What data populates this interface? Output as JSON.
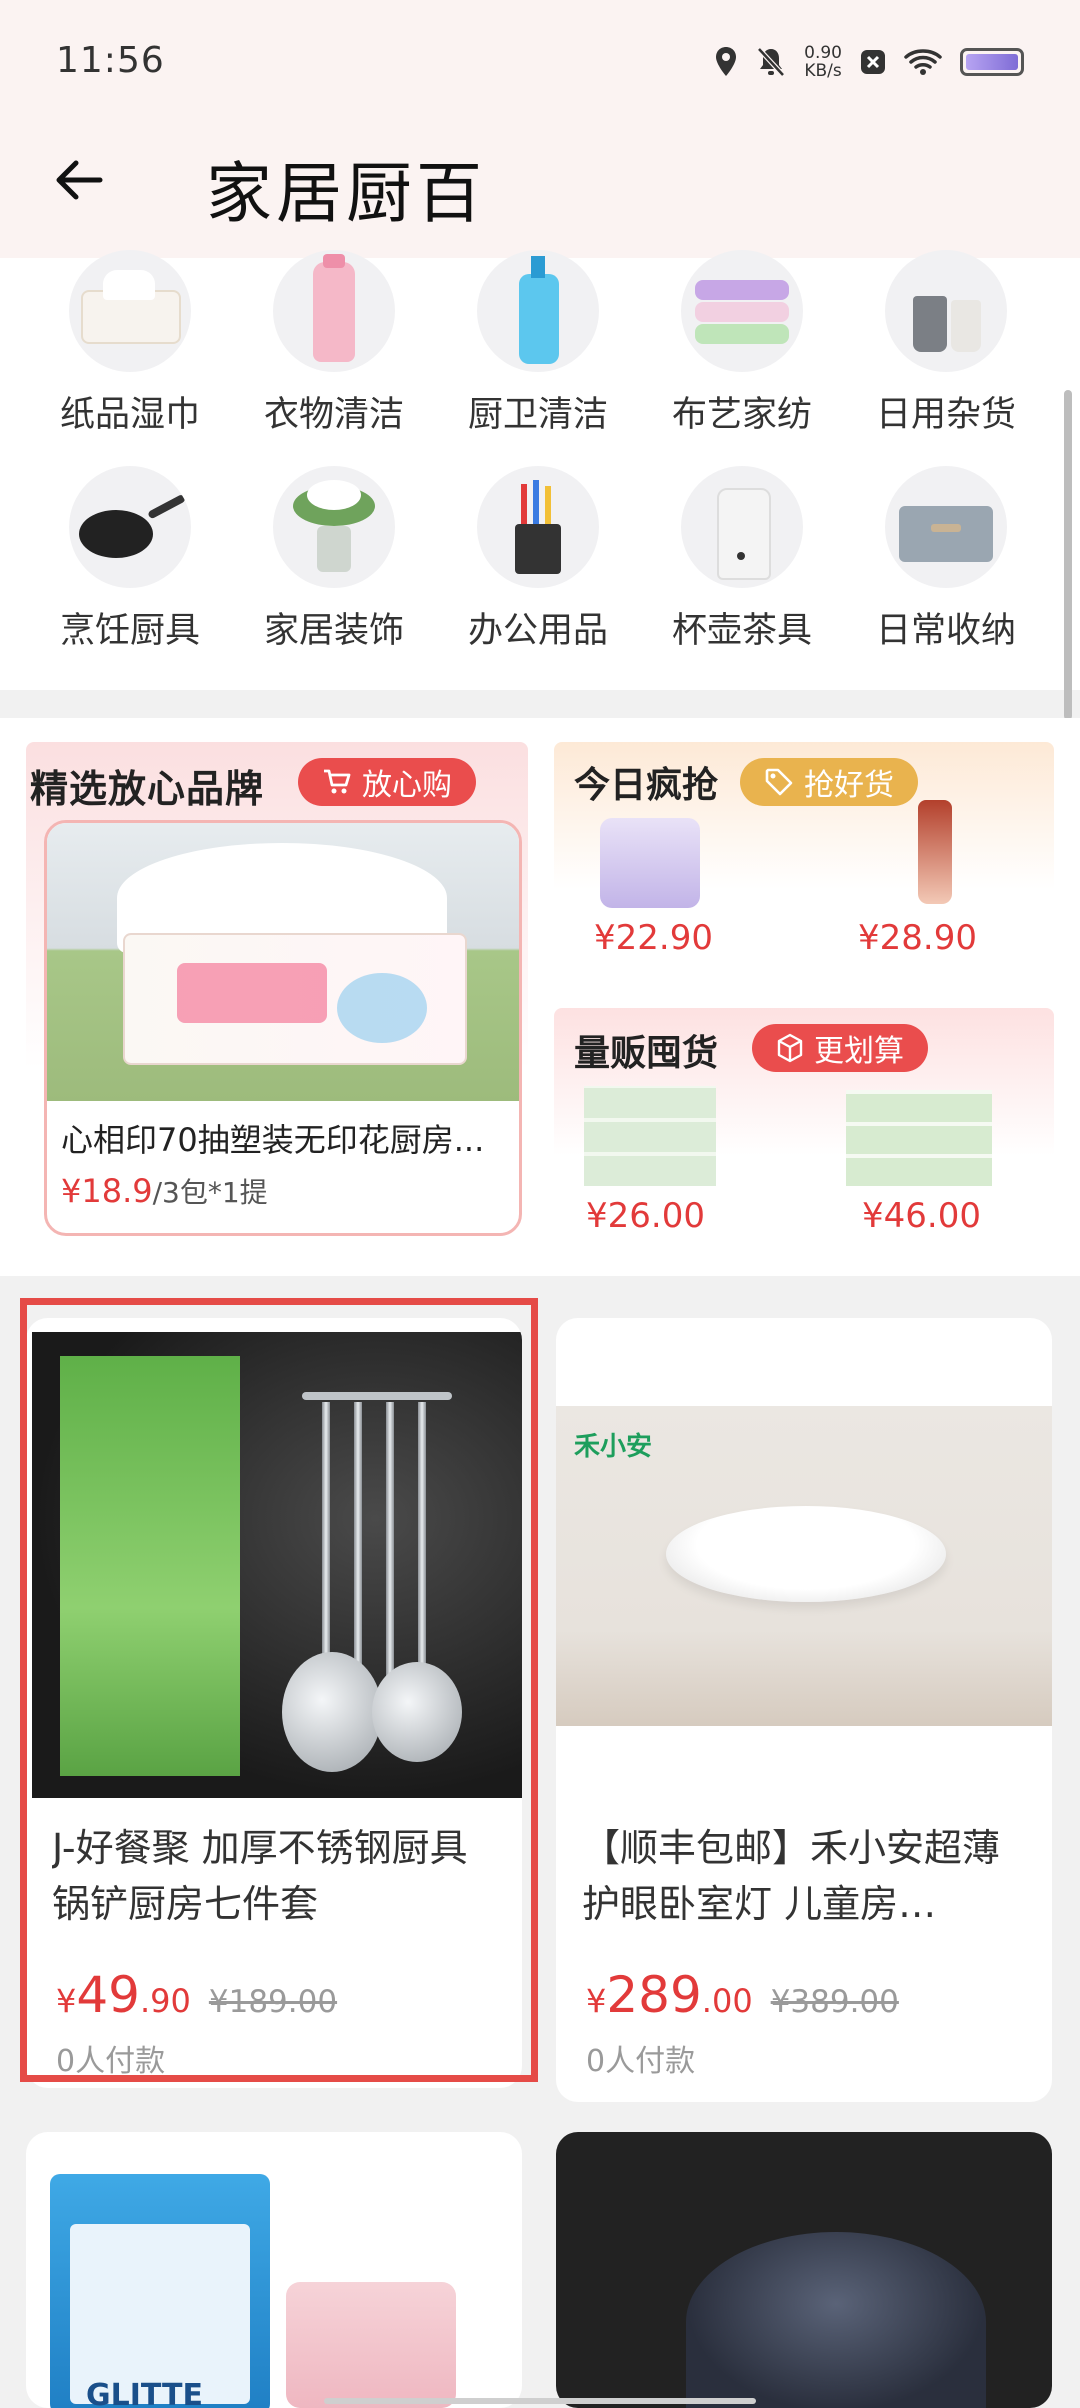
{
  "status_bar": {
    "time": "11:56",
    "net_speed": "0.90",
    "net_unit": "KB/s"
  },
  "header": {
    "title": "家居厨百"
  },
  "categories": [
    {
      "label": "纸品湿巾",
      "icon": "tissue-icon"
    },
    {
      "label": "衣物清洁",
      "icon": "detergent-bottle-icon"
    },
    {
      "label": "厨卫清洁",
      "icon": "cleaner-bottle-icon"
    },
    {
      "label": "布艺家纺",
      "icon": "towels-icon"
    },
    {
      "label": "日用杂货",
      "icon": "cups-icon"
    },
    {
      "label": "烹饪厨具",
      "icon": "frying-pan-icon"
    },
    {
      "label": "家居装饰",
      "icon": "flower-vase-icon"
    },
    {
      "label": "办公用品",
      "icon": "pen-holder-icon"
    },
    {
      "label": "杯壶茶具",
      "icon": "kettle-icon"
    },
    {
      "label": "日常收纳",
      "icon": "storage-box-icon"
    }
  ],
  "brand_section": {
    "title": "精选放心品牌",
    "badge": "放心购",
    "product_name": "心相印70抽塑装无印花厨房...",
    "price": "¥18.9",
    "unit": "/3包*1提"
  },
  "today_section": {
    "title": "今日疯抢",
    "badge": "抢好货",
    "prices": [
      "¥22.90",
      "¥28.90"
    ]
  },
  "bulk_section": {
    "title": "量贩囤货",
    "badge": "更划算",
    "prices": [
      "¥26.00",
      "¥46.00"
    ]
  },
  "products": [
    {
      "title": "J-好餐聚 加厚不锈钢厨具锅铲厨房七件套",
      "currency": "¥",
      "price_int": "49",
      "price_dec": ".90",
      "old_price": "¥189.00",
      "paid": "0人付款"
    },
    {
      "brand": "禾小安",
      "title": "【顺丰包邮】禾小安超薄护眼卧室灯 儿童房…",
      "currency": "¥",
      "price_int": "289",
      "price_dec": ".00",
      "old_price": "¥389.00",
      "paid": "0人付款"
    },
    {
      "brand": "GLITTE"
    }
  ],
  "colors": {
    "accent": "#e23a3a",
    "badge_red": "#ea4d4d",
    "badge_gold": "#e9b34e",
    "highlight": "#e54b47"
  }
}
